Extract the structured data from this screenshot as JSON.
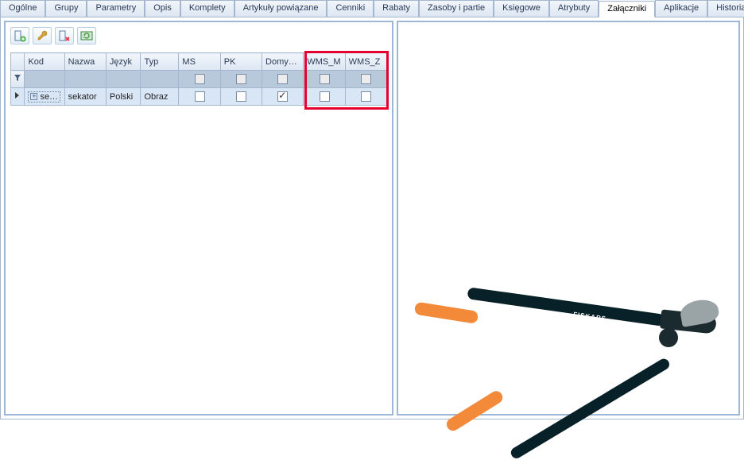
{
  "tabs": [
    {
      "label": "Ogólne"
    },
    {
      "label": "Grupy"
    },
    {
      "label": "Parametry"
    },
    {
      "label": "Opis"
    },
    {
      "label": "Komplety"
    },
    {
      "label": "Artykuły powiązane"
    },
    {
      "label": "Cenniki"
    },
    {
      "label": "Rabaty"
    },
    {
      "label": "Zasoby i partie"
    },
    {
      "label": "Księgowe"
    },
    {
      "label": "Atrybuty"
    },
    {
      "label": "Załączniki",
      "active": true
    },
    {
      "label": "Aplikacje"
    },
    {
      "label": "Historia zmian"
    }
  ],
  "grid": {
    "columns": [
      {
        "key": "kod",
        "label": "Kod"
      },
      {
        "key": "nazwa",
        "label": "Nazwa"
      },
      {
        "key": "jezyk",
        "label": "Język"
      },
      {
        "key": "typ",
        "label": "Typ"
      },
      {
        "key": "ms",
        "label": "MS"
      },
      {
        "key": "pk",
        "label": "PK"
      },
      {
        "key": "domy",
        "label": "Domy…"
      },
      {
        "key": "wmsm",
        "label": "WMS_M"
      },
      {
        "key": "wmsz",
        "label": "WMS_Z"
      }
    ],
    "rows": [
      {
        "kod": "se…",
        "nazwa": "sekator",
        "jezyk": "Polski",
        "typ": "Obraz",
        "ms": false,
        "pk": false,
        "domy": true,
        "wmsm": false,
        "wmsz": false
      }
    ]
  },
  "product_brand": "FISKARS"
}
